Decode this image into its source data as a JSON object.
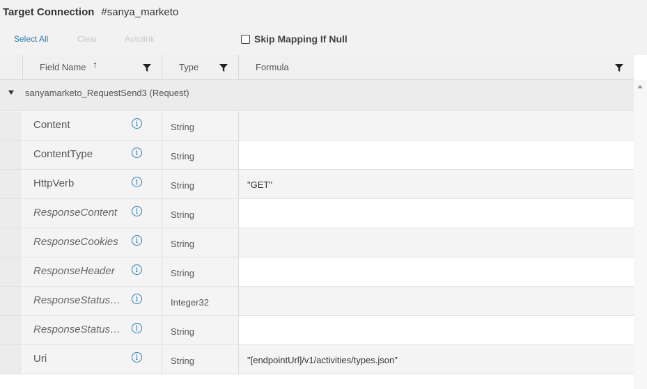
{
  "header": {
    "title": "Target Connection",
    "connection": "#sanya_marketo"
  },
  "toolbar": {
    "select_all": "Select All",
    "clear": "Clear",
    "autolink": "Autolink",
    "skip_mapping": "Skip Mapping If Null",
    "skip_checked": false
  },
  "columns": {
    "field_name": "Field Name",
    "sort_arrow": "↑",
    "type": "Type",
    "formula": "Formula"
  },
  "group": {
    "label": "sanyamarketo_RequestSend3 (Request)"
  },
  "rows": [
    {
      "name": "Content",
      "type": "String",
      "formula": "",
      "italic": false,
      "info": "i"
    },
    {
      "name": "ContentType",
      "type": "String",
      "formula": "",
      "italic": false,
      "info": "i"
    },
    {
      "name": "HttpVerb",
      "type": "String",
      "formula": "\"GET\"",
      "italic": false,
      "info": "i"
    },
    {
      "name": "ResponseContent",
      "type": "String",
      "formula": "",
      "italic": true,
      "info": "i"
    },
    {
      "name": "ResponseCookies",
      "type": "String",
      "formula": "",
      "italic": true,
      "info": "i"
    },
    {
      "name": "ResponseHeader",
      "type": "String",
      "formula": "",
      "italic": true,
      "info": "i"
    },
    {
      "name": "ResponseStatus…",
      "type": "Integer32",
      "formula": "",
      "italic": true,
      "info": "i"
    },
    {
      "name": "ResponseStatus…",
      "type": "String",
      "formula": "",
      "italic": true,
      "info": "i"
    },
    {
      "name": "Uri",
      "type": "String",
      "formula": "\"[endpointUrl]/v1/activities/types.json\"",
      "italic": false,
      "info": "i"
    }
  ],
  "icons": {
    "filter": "funnel-icon",
    "info": "info-icon",
    "expand": "caret-down-icon",
    "scroll": "scroll-up-icon"
  },
  "colors": {
    "link": "#2a7ab8",
    "disabled": "#c9c9c9"
  }
}
